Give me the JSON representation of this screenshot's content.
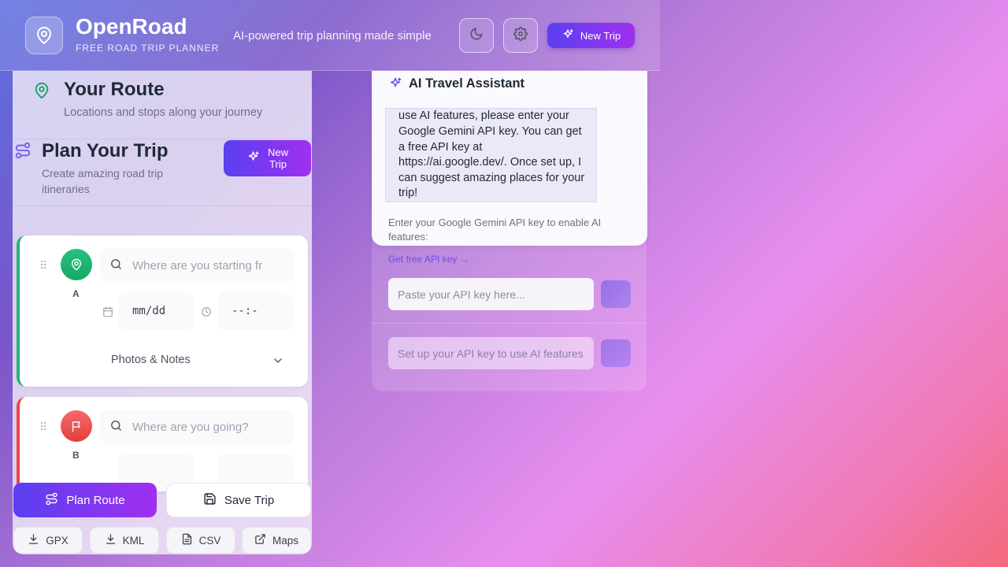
{
  "header": {
    "app_title": "OpenRoad",
    "app_subtitle": "FREE ROAD TRIP PLANNER",
    "tagline": "AI-powered trip planning made simple",
    "new_trip_label": "New Trip",
    "icons": [
      "map-pin-icon",
      "moon-icon",
      "gear-icon",
      "sparkles-icon"
    ]
  },
  "route_panel": {
    "title": "Your Route",
    "subtitle": "Locations and stops along your journey"
  },
  "plan_panel": {
    "title": "Plan Your Trip",
    "subtitle": "Create amazing road trip itineraries",
    "new_trip_label_line1": "New",
    "new_trip_label_line2": "Trip"
  },
  "stops": [
    {
      "letter": "A",
      "placeholder": "Where are you starting fr",
      "date_value": "mm/dd",
      "time_value": "--:-",
      "details_label": "Photos & Notes",
      "color": "#22b573"
    },
    {
      "letter": "B",
      "placeholder": "Where are you going?",
      "color": "#ef4444"
    }
  ],
  "actions": {
    "plan_route": "Plan Route",
    "save_trip": "Save Trip",
    "exports": [
      "GPX",
      "KML",
      "CSV",
      "Maps"
    ]
  },
  "ai_assistant": {
    "title": "AI Travel Assistant",
    "message": "use AI features, please enter your Google Gemini API key. You can get a free API key at https://ai.google.dev/. Once set up, I can suggest amazing places for your trip!",
    "hint": "Enter your Google Gemini API key to enable AI features:",
    "api_link": "Get free API key →",
    "api_placeholder": "Paste your API key here...",
    "chat_placeholder": "Set up your API key to use AI features"
  },
  "colors": {
    "accent_start": "#5b3ff0",
    "accent_end": "#a02ff0",
    "start_marker": "#22b573",
    "end_marker": "#ef4444",
    "link": "#6d4cf0"
  }
}
